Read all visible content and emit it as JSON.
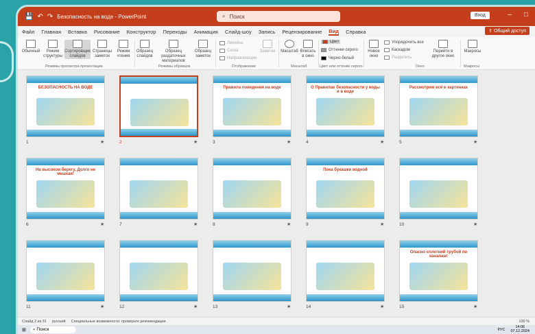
{
  "titlebar": {
    "doc_title": "Безопасность на воде - PowerPoint",
    "search": "Поиск",
    "login": "Вход"
  },
  "menu": [
    "Файл",
    "Главная",
    "Вставка",
    "Рисование",
    "Конструктор",
    "Переходы",
    "Анимация",
    "Слайд-шоу",
    "Запись",
    "Рецензирование",
    "Вид",
    "Справка"
  ],
  "menu_active": "Вид",
  "share": "Общий доступ",
  "ribbon": {
    "views": [
      "Обычный",
      "Режим структуры",
      "Сортировщик слайдов",
      "Страницы заметок",
      "Режим чтения"
    ],
    "masters": [
      "Образец слайдов",
      "Образец раздаточных материалов",
      "Образец заметок"
    ],
    "show": [
      "Линейка",
      "Сетка",
      "Направляющие"
    ],
    "notes": "Заметки",
    "zoom": [
      "Масштаб",
      "Вписать в окно"
    ],
    "color": [
      "Цвет",
      "Оттенки серого",
      "Черно-белый"
    ],
    "window": [
      "Новое окно",
      "Упорядочить все",
      "Каскадом",
      "Разделить"
    ],
    "switch": "Перейти в другое окно",
    "macros": "Макросы",
    "groups": [
      "Режимы просмотра презентации",
      "Режимы образцов",
      "Отображение",
      "Масштаб",
      "Цвет или оттенки серого",
      "Окно",
      "Макросы"
    ]
  },
  "slides": [
    {
      "n": "1",
      "title": "БЕЗОПАСНОСТЬ НА ВОДЕ"
    },
    {
      "n": "2",
      "title": ""
    },
    {
      "n": "3",
      "title": "Правила поведения на воде"
    },
    {
      "n": "4",
      "title": "О Правилах безопасности у воды и в воде"
    },
    {
      "n": "5",
      "title": "Рассмотрим всё в картинках"
    },
    {
      "n": "6",
      "title": "На высоком берегу, Долго не мешкая!"
    },
    {
      "n": "7",
      "title": ""
    },
    {
      "n": "8",
      "title": ""
    },
    {
      "n": "9",
      "title": "Пока букашки водной"
    },
    {
      "n": "10",
      "title": ""
    },
    {
      "n": "11",
      "title": ""
    },
    {
      "n": "12",
      "title": ""
    },
    {
      "n": "13",
      "title": ""
    },
    {
      "n": "14",
      "title": ""
    },
    {
      "n": "15",
      "title": "Опасно сплетний трубой по каналам!"
    }
  ],
  "status": {
    "slide": "Слайд 2 из 31",
    "lang": "русский",
    "access": "Специальные возможности: проверьте рекомендации",
    "zoom": "100 %"
  },
  "taskbar": {
    "search": "Поиск",
    "lang": "РУС",
    "time": "14:06",
    "date": "07.12.2024"
  }
}
